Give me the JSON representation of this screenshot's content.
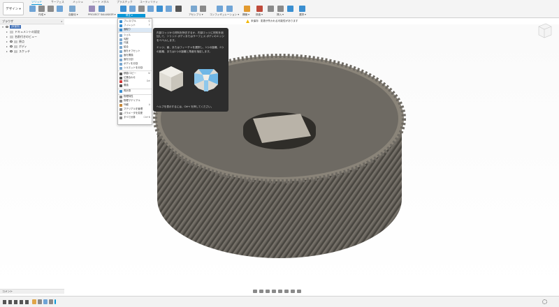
{
  "workspace": {
    "label": "デザイン ▾"
  },
  "tabs": [
    {
      "label": "ソリッド",
      "active": true
    },
    {
      "label": "サーフェス"
    },
    {
      "label": "メッシュ"
    },
    {
      "label": "シート メタル"
    },
    {
      "label": "プラスチック"
    },
    {
      "label": "ユーティリティ"
    }
  ],
  "groups": {
    "create": "作成 ▾",
    "automate": "自動化 ▾",
    "project": "PROJECT SALVADOR ▾",
    "modify": "修正 ▾",
    "assemble": "アセンブリ ▾",
    "configure": "コンフィギュレーション ▾",
    "construct": "構築 ▾",
    "inspect": "検査 ▾",
    "insert": "挿入 ▾",
    "select": "選択 ▾"
  },
  "warning": {
    "label": "未保存:",
    "text": "変更が失われる可能性があります"
  },
  "browser": {
    "title": "ブラウザ",
    "root": "(未保存)",
    "items": [
      "ドキュメントの設定",
      "名前付きのビュー",
      "原点",
      "ボディ",
      "スケッチ"
    ]
  },
  "menu": {
    "items": [
      {
        "label": "プレス/プル",
        "key": "Q",
        "icon": "press-pull-icon",
        "color": "#3a8fd1"
      },
      {
        "label": "フィレット",
        "key": "F",
        "icon": "fillet-icon",
        "color": "#3a8fd1"
      },
      {
        "label": "面取り",
        "key": "",
        "icon": "chamfer-icon",
        "color": "#3a8fd1",
        "selected": true
      },
      {
        "label": "シェル",
        "key": "",
        "icon": "shell-icon",
        "color": "#7aa7cf"
      },
      {
        "label": "勾配",
        "key": "",
        "icon": "draft-icon",
        "color": "#7aa7cf"
      },
      {
        "label": "尺度",
        "key": "",
        "icon": "scale-icon",
        "color": "#7aa7cf"
      },
      {
        "label": "結合",
        "key": "",
        "icon": "combine-icon",
        "color": "#7aa7cf"
      },
      {
        "label": "面をオフセット",
        "key": "",
        "icon": "offset-face-icon",
        "color": "#7aa7cf"
      },
      {
        "label": "面を置換",
        "key": "",
        "icon": "replace-face-icon",
        "color": "#7aa7cf"
      },
      {
        "label": "面を分割",
        "key": "",
        "icon": "split-face-icon",
        "color": "#7aa7cf"
      },
      {
        "label": "ボディを分割",
        "key": "",
        "icon": "split-body-icon",
        "color": "#7aa7cf"
      },
      {
        "label": "シルエットを分割",
        "key": "",
        "icon": "silhouette-split-icon",
        "color": "#7aa7cf"
      },
      {
        "label": "移動/コピー",
        "key": "M",
        "icon": "move-icon",
        "color": "#555555"
      },
      {
        "label": "位置合わせ",
        "key": "",
        "icon": "align-icon",
        "color": "#555555"
      },
      {
        "label": "削除",
        "key": "Del",
        "icon": "delete-icon",
        "color": "#d23b3b"
      },
      {
        "label": "置換",
        "key": "",
        "icon": "replace-icon",
        "color": "#555555"
      },
      {
        "label": "再計算",
        "key": "",
        "icon": "recompute-icon",
        "color": "#3a8fd1"
      },
      {
        "label": "物理特性",
        "key": "",
        "icon": "physical-material-icon",
        "color": "#888888"
      },
      {
        "label": "物理マテリアル",
        "key": "",
        "icon": "appearance-icon",
        "color": "#888888"
      },
      {
        "label": "外観",
        "key": "A",
        "icon": "material-icon",
        "color": "#c98a3a"
      },
      {
        "label": "マテリアルを管理",
        "key": "",
        "icon": "manage-materials-icon",
        "color": "#888888"
      },
      {
        "label": "パラメータを変更",
        "key": "",
        "icon": "change-parameters-icon",
        "color": "#888888"
      },
      {
        "label": "すべて計算",
        "key": "Ctrl+B",
        "icon": "compute-all-icon",
        "color": "#888888"
      }
    ]
  },
  "tooltip": {
    "para1": "内部エッジから材料を除去するか、内部エッジに材料を追加して、ソリッド ボディまたはサーフェス ボディのエッジをベベルします。",
    "para2": "エッジ、面、またはフィーチャを選択し、1つの距離、2つの距離、または1つの距離と角度を指定します。",
    "help": "ヘルプを表示するには、Ctrl+/ を押してください。"
  },
  "comment": {
    "label": "コメント"
  },
  "colors": {
    "accent": "#0696d7",
    "gear": "#6e6a63",
    "gear_dark": "#4a4741",
    "gear_light": "#8f8a81",
    "tooltip_bg": "#2d2d2d"
  }
}
